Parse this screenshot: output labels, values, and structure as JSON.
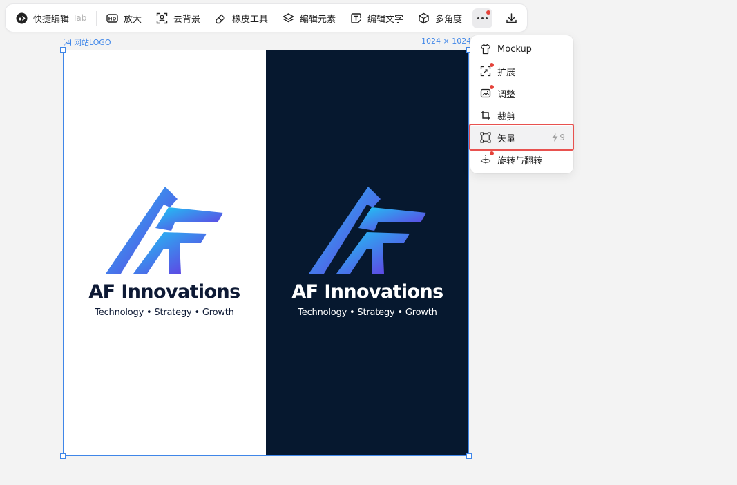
{
  "toolbar": {
    "quick_edit_label": "快捷编辑",
    "quick_edit_hint": "Tab",
    "upscale_label": "放大",
    "remove_bg_label": "去背景",
    "eraser_label": "橡皮工具",
    "edit_elements_label": "编辑元素",
    "edit_text_label": "编辑文字",
    "multi_angle_label": "多角度",
    "more_icon": "more-dots-icon",
    "download_icon": "download-icon"
  },
  "canvas": {
    "name": "网站LOGO",
    "size": "1024 × 1024"
  },
  "logo": {
    "brand_name": "AF Innovations",
    "tagline": "Technology • Strategy • Growth",
    "light_bg": "#ffffff",
    "dark_bg": "#06182f",
    "gradient_start": "#1ec8f5",
    "gradient_end": "#6a2fe0"
  },
  "menu": {
    "items": [
      {
        "label": "Mockup",
        "icon": "tshirt-icon"
      },
      {
        "label": "扩展",
        "icon": "expand-icon"
      },
      {
        "label": "调整",
        "icon": "adjust-image-icon"
      },
      {
        "label": "裁剪",
        "icon": "crop-icon"
      },
      {
        "label": "矢量",
        "icon": "vector-icon",
        "credit": "9"
      },
      {
        "label": "旋转与翻转",
        "icon": "rotate-flip-icon"
      }
    ]
  },
  "colors": {
    "accent": "#3f86e8",
    "badge_red": "#e5433a",
    "highlight": "#e8524f"
  }
}
